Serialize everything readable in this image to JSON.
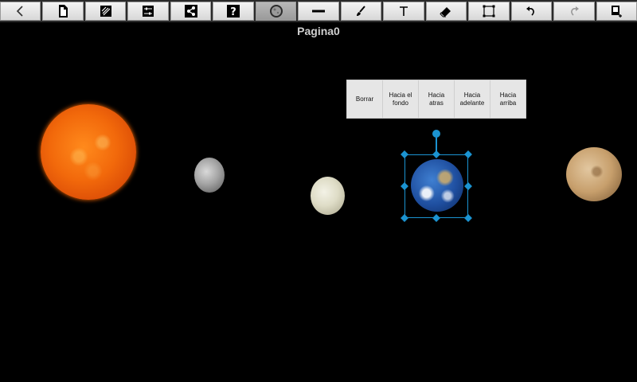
{
  "toolbar": {
    "buttons": [
      {
        "name": "back-button",
        "icon": "chevron-left-icon"
      },
      {
        "name": "new-page-button",
        "icon": "document-icon"
      },
      {
        "name": "clipboard-button",
        "icon": "paste-icon"
      },
      {
        "name": "settings-button",
        "icon": "sliders-icon"
      },
      {
        "name": "share-button",
        "icon": "share-icon"
      },
      {
        "name": "help-button",
        "icon": "question-icon"
      },
      {
        "name": "image-tool-button",
        "icon": "moon-image-icon",
        "active": true
      },
      {
        "name": "line-tool-button",
        "icon": "line-icon"
      },
      {
        "name": "brush-tool-button",
        "icon": "brush-icon"
      },
      {
        "name": "text-tool-button",
        "icon": "text-icon",
        "label": "T"
      },
      {
        "name": "eraser-tool-button",
        "icon": "eraser-icon"
      },
      {
        "name": "select-tool-button",
        "icon": "selection-box-icon"
      },
      {
        "name": "undo-button",
        "icon": "undo-icon"
      },
      {
        "name": "redo-button",
        "icon": "redo-icon"
      },
      {
        "name": "add-page-button",
        "icon": "add-page-icon"
      }
    ],
    "help_label": "?"
  },
  "page": {
    "title": "Pagina0"
  },
  "context_menu": {
    "items": [
      "Borrar",
      "Hacia el fondo",
      "Hacia atras",
      "Hacia adelante",
      "Hacia arriba"
    ]
  },
  "canvas": {
    "planets": [
      "sun-image",
      "mercury-image",
      "venus-image",
      "earth-image",
      "mars-image"
    ],
    "selected": "earth-image"
  },
  "colors": {
    "selection": "#1b93d1",
    "background": "#000000"
  }
}
